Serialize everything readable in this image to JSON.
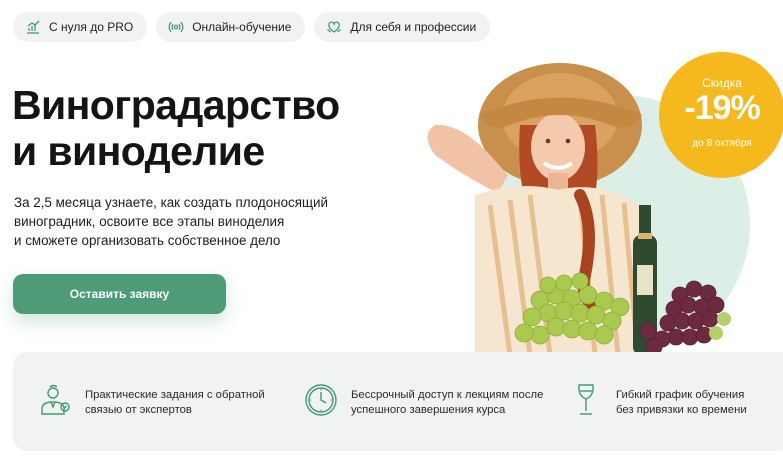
{
  "tags": [
    {
      "label": "С нуля до PRO",
      "icon": "growth-chart-icon"
    },
    {
      "label": "Онлайн-обучение",
      "icon": "broadcast-icon"
    },
    {
      "label": "Для себя и профессии",
      "icon": "heart-hands-icon"
    }
  ],
  "hero": {
    "title_line1": "Виноградарство",
    "title_line2": "и виноделие",
    "description_line1": "За 2,5 месяца узнаете, как создать плодоносящий",
    "description_line2": "виноградник, освоите все этапы виноделия",
    "description_line3": "и сможете организовать собственное дело",
    "cta_label": "Оставить заявку",
    "image_alt": "woman-in-straw-hat-with-grapes-and-wine"
  },
  "badge": {
    "top": "Скидка",
    "value": "-19%",
    "bottom": "до 8 октября"
  },
  "features": [
    {
      "line1": "Практические задания с обратной",
      "line2": "связью от экспертов",
      "icon": "expert-person-icon"
    },
    {
      "line1": "Бессрочный доступ к лекциям после",
      "line2": "успешного завершения курса",
      "icon": "clock-icon"
    },
    {
      "line1": "Гибкий график обучения",
      "line2": "без привязки ко времени",
      "icon": "wine-glass-icon"
    }
  ],
  "colors": {
    "accent_green": "#4d9c77",
    "badge_yellow": "#f5b91d",
    "tag_bg": "#f1f2f2",
    "icon_green": "#3f9b73"
  }
}
